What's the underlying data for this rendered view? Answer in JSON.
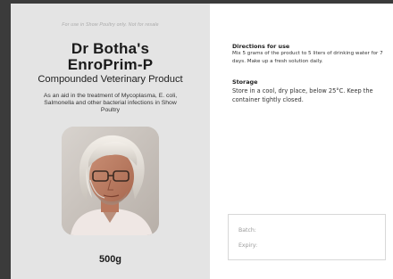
{
  "label": {
    "disclaimer": "For use in Show Poultry only. Not for resale",
    "title_line1": "Dr Botha's",
    "title_line2": "EnroPrim-P",
    "product_type": "Compounded Veterinary Product",
    "description": "As an aid in the treatment of Mycoplasma, E. coli, Salmonella and other bacterial infections in Show Poultry",
    "weight": "500g"
  },
  "directions": {
    "heading": "Directions for use",
    "text": "Mix 5 grams of the product to 5 liters of drinking water for 7 days. Make up a fresh solution daily."
  },
  "storage": {
    "heading": "Storage",
    "text": "Store in a cool, dry place, below 25°C. Keep the container tightly closed."
  },
  "batch_box": {
    "batch_label": "Batch:",
    "expiry_label": "Expiry:"
  },
  "colors": {
    "background": "#3b3b3b",
    "left_panel": "#e4e4e4",
    "right_panel": "#ffffff"
  }
}
